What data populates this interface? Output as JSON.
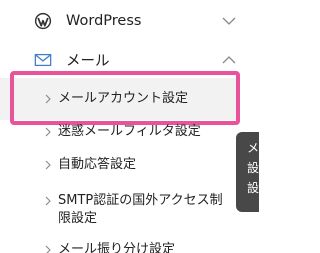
{
  "nav": {
    "wordpress": {
      "label": "WordPress",
      "icon": "wordpress-icon"
    },
    "mail": {
      "label": "メール",
      "icon": "mail-icon",
      "expanded": true,
      "items": [
        {
          "label": "メールアカウント設定",
          "selected": true
        },
        {
          "label": "迷惑メールフィルタ設定"
        },
        {
          "label": "自動応答設定"
        },
        {
          "label_line1": "SMTP認証の国外アクセス制",
          "label_line2": "限設定"
        },
        {
          "label": "メール振り分け設定"
        }
      ]
    }
  },
  "side_tab": {
    "line1": "メ",
    "line2": "設",
    "line3": "設"
  },
  "colors": {
    "highlight": "#e9539a",
    "accent_mail": "#3f7fc9",
    "side_tab_bg": "#484848"
  }
}
